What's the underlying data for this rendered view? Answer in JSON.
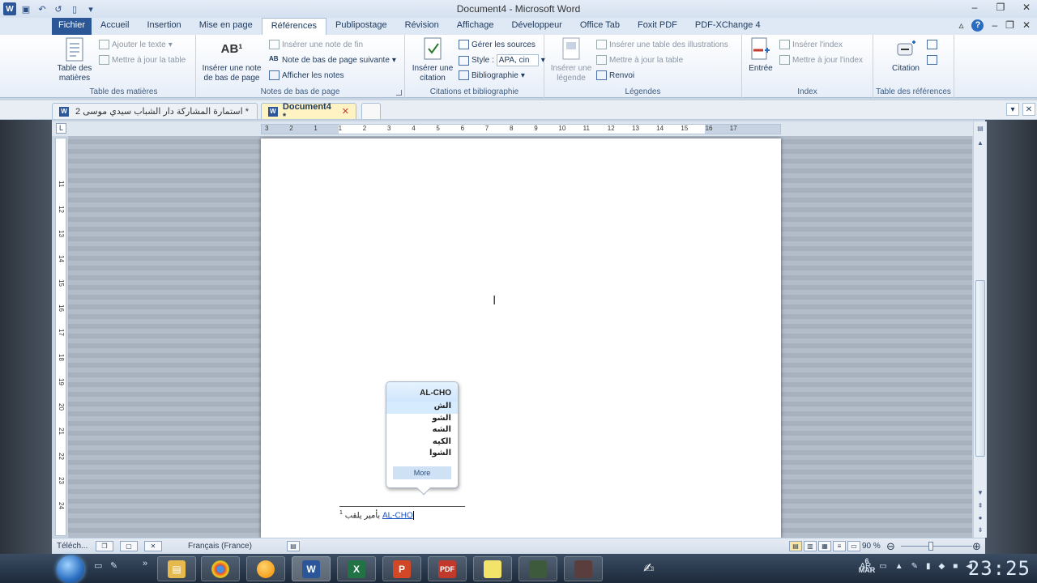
{
  "window": {
    "title": "Document4 - Microsoft Word",
    "undo_glyph": "↶",
    "redo_glyph": "↺",
    "minimize": "–",
    "restore": "❐",
    "close": "✕"
  },
  "ribbon_tabs": [
    "Fichier",
    "Accueil",
    "Insertion",
    "Mise en page",
    "Références",
    "Publipostage",
    "Révision",
    "Affichage",
    "Développeur",
    "Office Tab",
    "Foxit PDF",
    "PDF-XChange 4"
  ],
  "active_tab": "Références",
  "groups": {
    "toc": {
      "label": "Table des matières",
      "big": "Table des matières",
      "add_text": "Ajouter le texte",
      "update": "Mettre à jour la table"
    },
    "footnotes": {
      "label": "Notes de bas de page",
      "big": "Insérer une note de bas de page",
      "big_icon": "AB¹",
      "endnote": "Insérer une note de fin",
      "next": "Note de bas de page suivante",
      "show": "Afficher les notes"
    },
    "citations": {
      "label": "Citations et bibliographie",
      "big": "Insérer une citation",
      "manage": "Gérer les sources",
      "style_label": "Style :",
      "style_value": "APA, cin",
      "bibliography": "Bibliographie"
    },
    "captions": {
      "label": "Légendes",
      "big": "Insérer une légende",
      "table_ill": "Insérer une table des illustrations",
      "update": "Mettre à jour la table",
      "crossref": "Renvoi"
    },
    "index": {
      "label": "Index",
      "big": "Entrée",
      "insert": "Insérer l'index",
      "update": "Mettre à jour l'index"
    },
    "toa": {
      "label": "Table des références",
      "big": "Citation"
    }
  },
  "doc_tabs": [
    {
      "label": "استمارة المشاركة دار الشباب سيدي موسى 2 *",
      "active": false
    },
    {
      "label": "Document4 *",
      "active": true
    }
  ],
  "ruler": {
    "corner": "L",
    "h_labels": [
      "3",
      "2",
      "1",
      "1",
      "2",
      "3",
      "4",
      "5",
      "6",
      "7",
      "8",
      "9",
      "10",
      "11",
      "12",
      "13",
      "14",
      "15",
      "16",
      "17"
    ],
    "v_labels": [
      "11",
      "12",
      "13",
      "14",
      "15",
      "16",
      "17",
      "18",
      "19",
      "20",
      "21",
      "22",
      "23",
      "24"
    ]
  },
  "popup": {
    "header": "AL-CHO",
    "items": [
      "الش",
      "الشو",
      "الشه",
      "الكيه",
      "الشوا"
    ],
    "more": "More"
  },
  "footnote": {
    "ref": "1",
    "arabic": "بأمير يلقب",
    "link": "AL-CHO"
  },
  "statusbar": {
    "left_text": "Téléch...",
    "language": "Français (France)",
    "zoom": "90 %"
  },
  "taskbar": {
    "lang": "AR",
    "date_day": "6",
    "date_month": "MAR",
    "time": "23:25"
  }
}
